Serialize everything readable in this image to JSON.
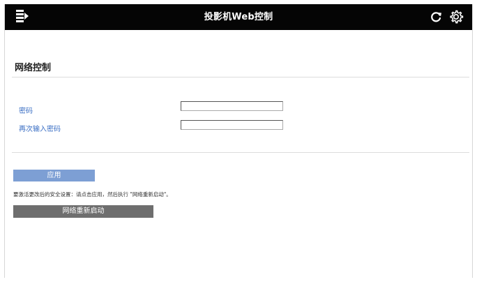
{
  "header": {
    "title": "投影机Web控制",
    "background_color": "#050505",
    "menu_icon": "document-arrow-icon",
    "refresh_icon": "refresh-icon",
    "settings_icon": "gear-icon"
  },
  "section": {
    "title": "网络控制"
  },
  "form": {
    "password_label": "密码",
    "password_value": "",
    "confirm_label": "再次输入密码",
    "confirm_value": ""
  },
  "actions": {
    "apply_label": "应用",
    "apply_color": "#7d9fd4",
    "note": "要激活更改后的安全设置：请点击应用，然后执行 \"网络重新启动\"。",
    "restart_label": "网络重新启动",
    "restart_color": "#6e6e6e",
    "label_color": "#3b6fc4"
  }
}
